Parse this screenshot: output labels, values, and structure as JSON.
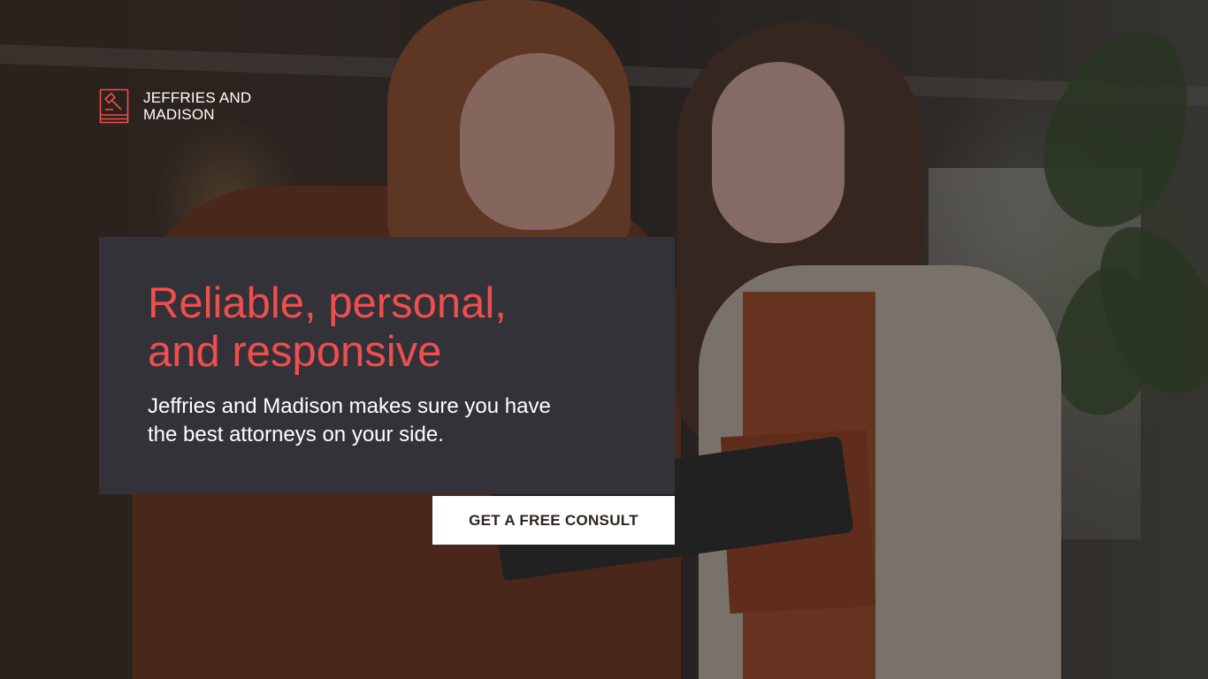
{
  "brand": {
    "name": "JEFFRIES AND MADISON",
    "icon": "gavel-book-icon",
    "accent_color": "#ef4e4e"
  },
  "hero": {
    "headline": "Reliable, personal, and responsive",
    "subtext": "Jeffries and Madison makes sure you have the best attorneys on your side.",
    "cta_label": "GET A FREE CONSULT",
    "panel_color": "#333238",
    "background_image": "two-women-looking-at-tablet-photo"
  }
}
